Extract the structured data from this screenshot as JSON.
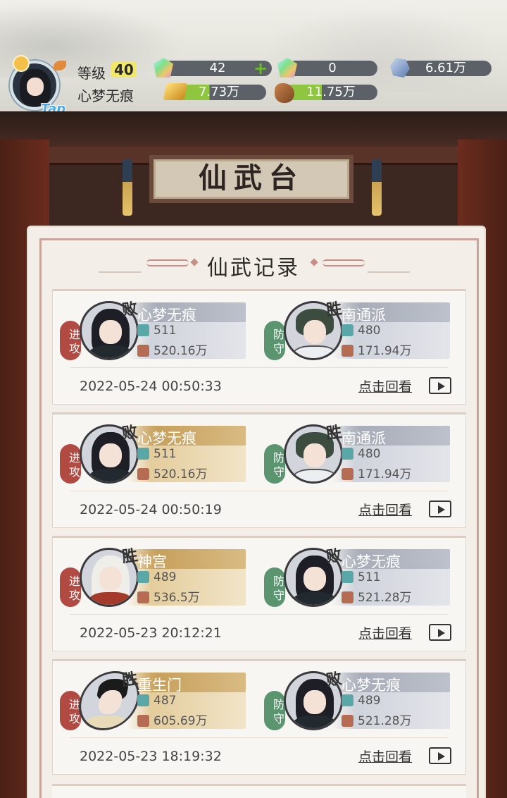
{
  "header": {
    "level_label": "等级",
    "level_value": "40",
    "player_name": "心梦无痕",
    "tap_label": "Tap",
    "resources": [
      {
        "icon": "rainbow-gem-icon",
        "value": "42"
      },
      {
        "icon": "gift-gem-icon",
        "value": "0"
      },
      {
        "icon": "spirit-stone-icon",
        "value": "6.61万"
      },
      {
        "icon": "gold-ingot-icon",
        "value": "7.73万"
      },
      {
        "icon": "wood-log-icon",
        "value": "11.75万"
      }
    ]
  },
  "stage": {
    "plaque": "仙武台"
  },
  "panel": {
    "title": "仙武记录",
    "replay_label": "点击回看"
  },
  "records": [
    {
      "attacker": {
        "role": "进攻",
        "result": "败",
        "name": "心梦无痕",
        "level": "511",
        "power": "520.16万"
      },
      "defender": {
        "role": "防守",
        "result": "胜",
        "name": "南通派",
        "level": "480",
        "power": "171.94万"
      },
      "time": "2022-05-24 00:50:33"
    },
    {
      "attacker": {
        "role": "进攻",
        "result": "败",
        "name": "心梦无痕",
        "level": "511",
        "power": "520.16万"
      },
      "defender": {
        "role": "防守",
        "result": "胜",
        "name": "南通派",
        "level": "480",
        "power": "171.94万"
      },
      "time": "2022-05-24 00:50:19"
    },
    {
      "attacker": {
        "role": "进攻",
        "result": "胜",
        "name": "神宫",
        "level": "489",
        "power": "536.5万"
      },
      "defender": {
        "role": "防守",
        "result": "败",
        "name": "心梦无痕",
        "level": "511",
        "power": "521.28万"
      },
      "time": "2022-05-23 20:12:21"
    },
    {
      "attacker": {
        "role": "进攻",
        "result": "胜",
        "name": "重生门",
        "level": "487",
        "power": "605.69万"
      },
      "defender": {
        "role": "防守",
        "result": "败",
        "name": "心梦无痕",
        "level": "489",
        "power": "521.28万"
      },
      "time": "2022-05-23 18:19:32"
    }
  ]
}
